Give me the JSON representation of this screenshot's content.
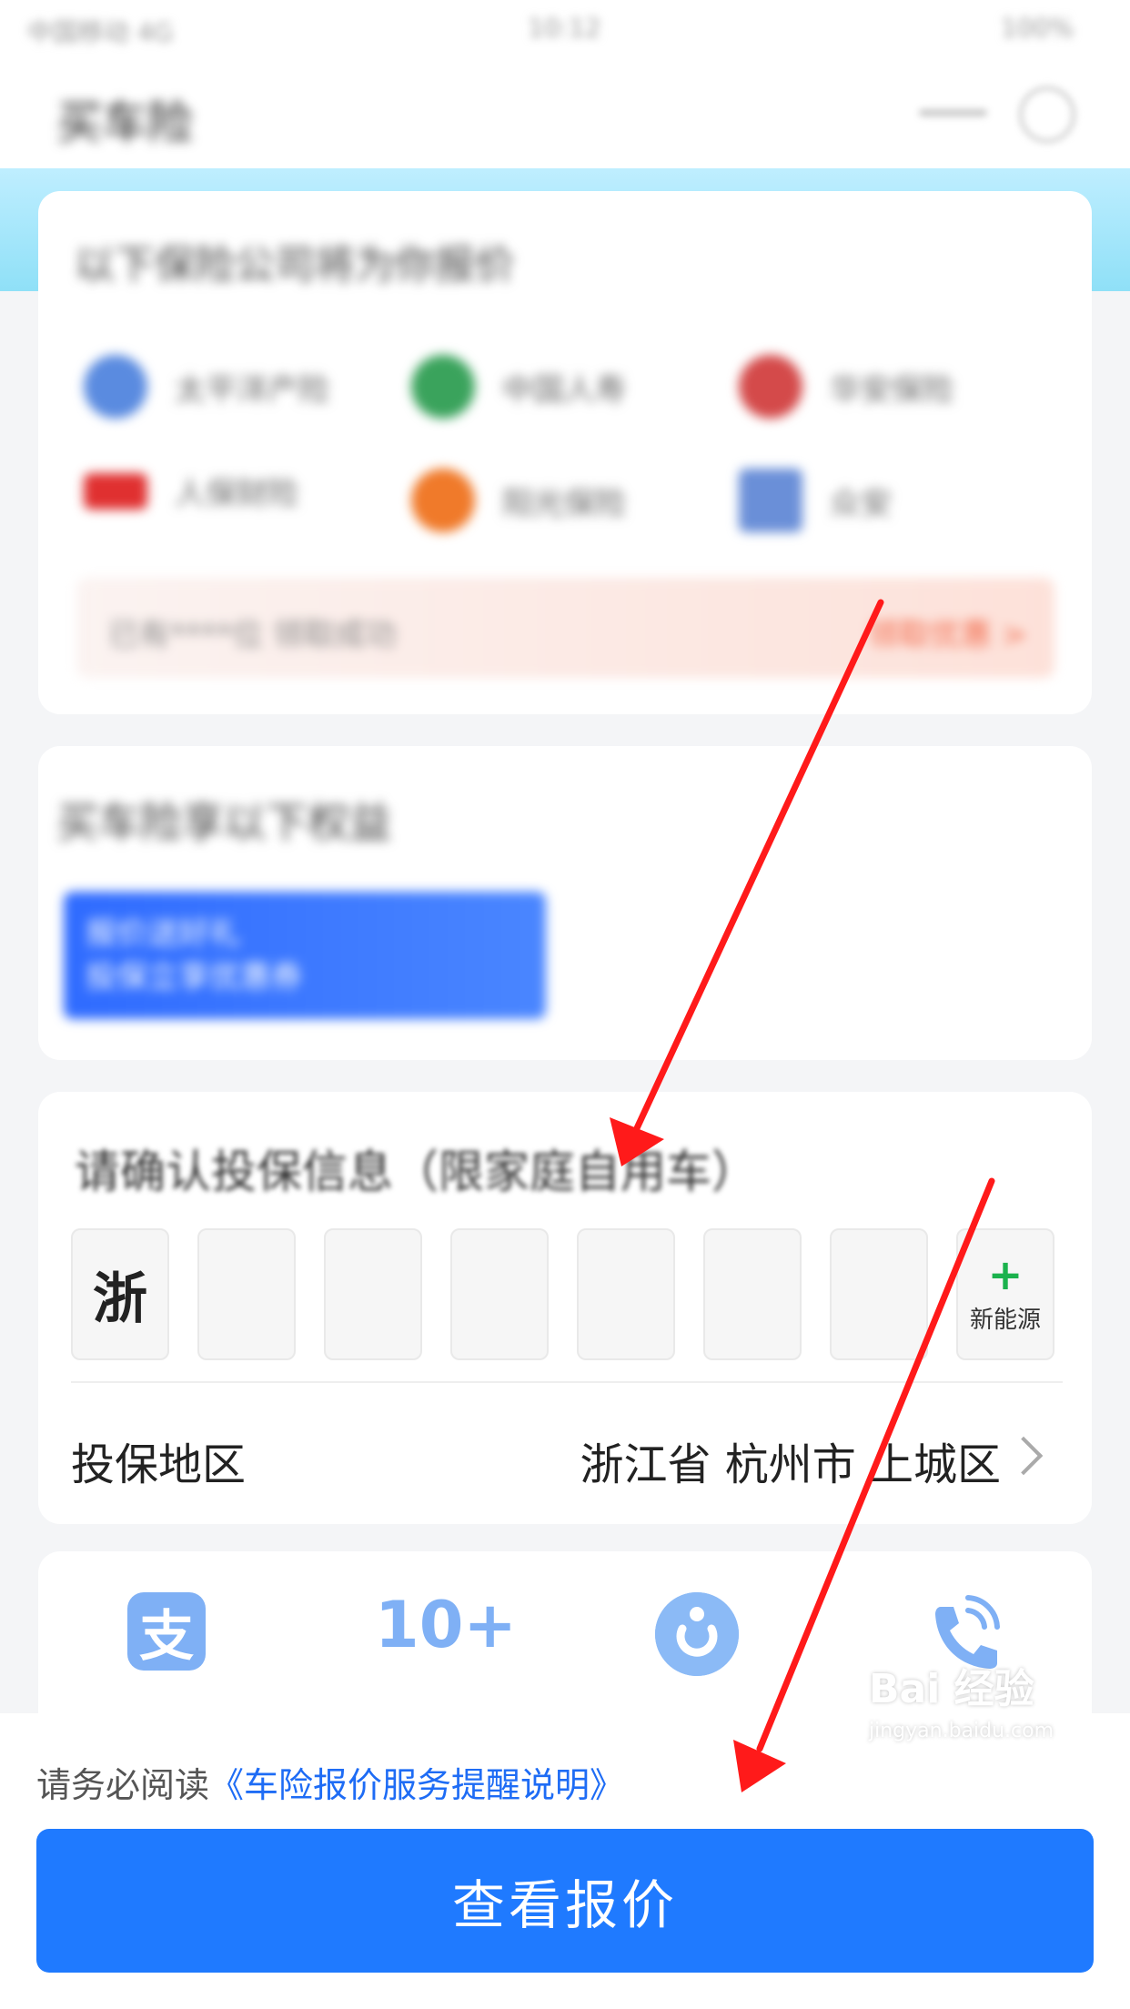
{
  "status_bar": {
    "carrier": "中国移动 4G",
    "time": "10:12",
    "battery": "100%"
  },
  "nav": {
    "title": "买车险"
  },
  "insurers_card": {
    "title": "以下保险公司将为你报价",
    "insurers": [
      {
        "name": "太平洋产险",
        "color": "#5a8be0"
      },
      {
        "name": "中国人寿",
        "color": "#3aa35c"
      },
      {
        "name": "华安保险",
        "color": "#d44a4a"
      },
      {
        "name": "人保财险",
        "color": "#e03030"
      },
      {
        "name": "阳光保险",
        "color": "#f07a2a"
      },
      {
        "name": "众安",
        "color": "#6a8fd8"
      }
    ],
    "promo_left": "已有****位 领取成功",
    "promo_right": "领取优惠 >"
  },
  "benefits_card": {
    "title": "买车险享以下权益",
    "banner_line1": "报价送好礼",
    "banner_line2": "投保立享优惠券"
  },
  "confirm_card": {
    "title": "请确认投保信息（限家庭自用车）",
    "plate_province": "浙",
    "ev_label": "新能源",
    "region_label": "投保地区",
    "region_value": "浙江省 杭州市 上城区"
  },
  "features": {
    "ten_label": "10+",
    "alipay_glyph": "支"
  },
  "bottom": {
    "notice_prefix": "请务必阅读",
    "notice_link": "《车险报价服务提醒说明》",
    "cta_label": "查看报价"
  },
  "watermark": {
    "main": "Bai  经验",
    "sub": "jingyan.baidu.com"
  },
  "colors": {
    "primary": "#1f7aff",
    "link": "#1e6cf5",
    "arrow": "#ff1a1a",
    "ev_green": "#1bb24d"
  }
}
